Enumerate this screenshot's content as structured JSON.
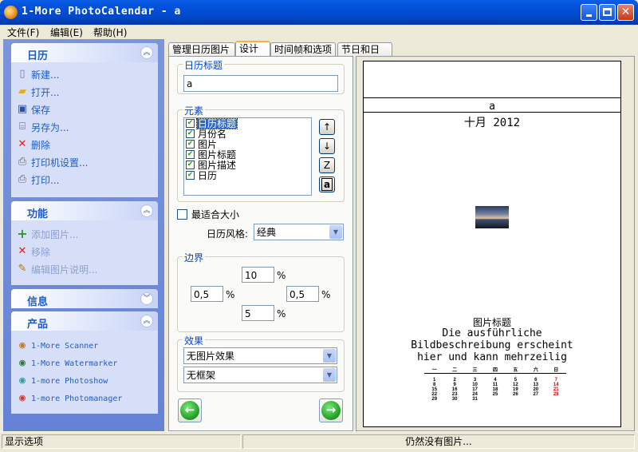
{
  "window": {
    "title": "1-More PhotoCalendar - a"
  },
  "menu": [
    {
      "label": "文件(F)"
    },
    {
      "label": "编辑(E)"
    },
    {
      "label": "帮助(H)"
    }
  ],
  "sidebar": {
    "calendar_group": {
      "title": "日历",
      "items": [
        {
          "label": "新建..."
        },
        {
          "label": "打开..."
        },
        {
          "label": "保存"
        },
        {
          "label": "另存为..."
        },
        {
          "label": "删除"
        },
        {
          "label": "打印机设置..."
        },
        {
          "label": "打印..."
        }
      ]
    },
    "functions_group": {
      "title": "功能",
      "items": [
        {
          "label": "添加图片..."
        },
        {
          "label": "移除"
        },
        {
          "label": "编辑图片说明..."
        }
      ]
    },
    "info_group": {
      "title": "信息"
    },
    "products_group": {
      "title": "产品",
      "items": [
        {
          "label": "1-More Scanner"
        },
        {
          "label": "1-More Watermarker"
        },
        {
          "label": "1-more Photoshow"
        },
        {
          "label": "1-more Photomanager"
        }
      ]
    }
  },
  "tabs": [
    {
      "label": "管理日历图片"
    },
    {
      "label": "设计"
    },
    {
      "label": "时间帧和选项"
    },
    {
      "label": "节日和日期"
    }
  ],
  "design": {
    "calendar_title_label": "日历标题",
    "calendar_title_value": "a",
    "elements_label": "元素",
    "elements": [
      {
        "label": "日历标题",
        "checked": true,
        "selected": true
      },
      {
        "label": "月份名",
        "checked": true
      },
      {
        "label": "图片",
        "checked": true
      },
      {
        "label": "图片标题",
        "checked": true
      },
      {
        "label": "图片描述",
        "checked": true
      },
      {
        "label": "日历",
        "checked": true
      }
    ],
    "side_buttons": {
      "font": "Z",
      "text": "a"
    },
    "best_fit_label": "最适合大小",
    "best_fit_checked": false,
    "style_label": "日历风格:",
    "style_value": "经典",
    "margins_label": "边界",
    "margins": {
      "top": "10",
      "left": "0,5",
      "right": "0,5",
      "bottom": "5",
      "unit": "%"
    },
    "effects_label": "效果",
    "effect_image": "无图片效果",
    "effect_frame": "无框架"
  },
  "preview": {
    "calendar_title": "a",
    "month": "十月 2012",
    "picture_title": "图片标题",
    "description": [
      "Die ausführliche",
      "Bildbeschreibung erscheint",
      "hier und kann mehrzeilig"
    ],
    "weekdays": [
      "一",
      "二",
      "三",
      "四",
      "五",
      "六",
      "日"
    ],
    "weeks": [
      [
        "1",
        "2",
        "3",
        "4",
        "5",
        "6",
        "7"
      ],
      [
        "8",
        "9",
        "10",
        "11",
        "12",
        "13",
        "14"
      ],
      [
        "15",
        "16",
        "17",
        "18",
        "19",
        "20",
        "21"
      ],
      [
        "22",
        "23",
        "24",
        "25",
        "26",
        "27",
        "28"
      ],
      [
        "29",
        "30",
        "31",
        "",
        "",
        "",
        ""
      ]
    ]
  },
  "status": {
    "left": "显示选项",
    "center": "仍然没有图片..."
  },
  "colors": {
    "accent": "#215DC6",
    "titlebar": "#0453DE",
    "sunday": "#D00000"
  }
}
